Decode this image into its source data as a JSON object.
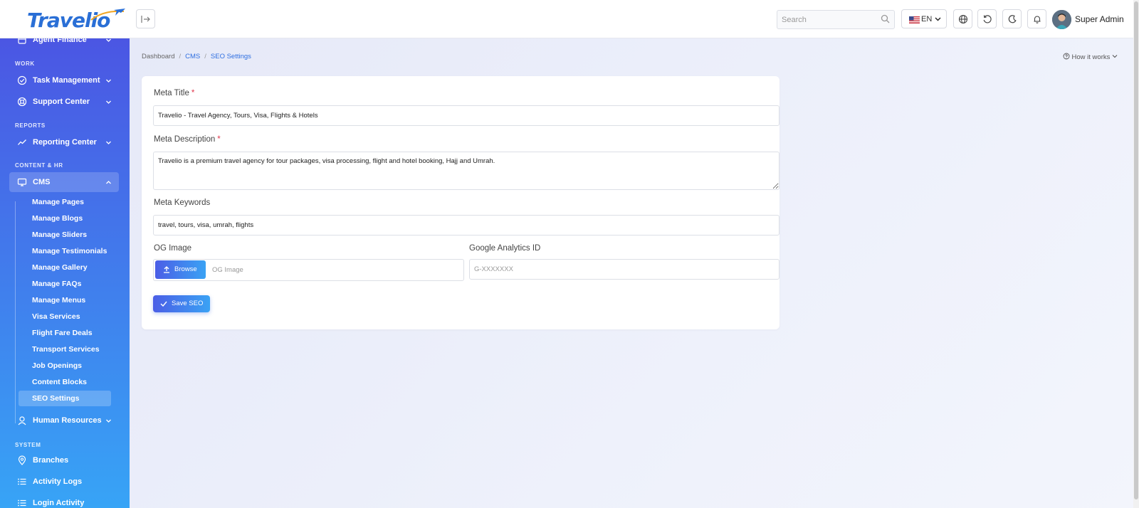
{
  "header": {
    "logo_text": "Travelio",
    "search_placeholder": "Search",
    "language": "EN",
    "user_name": "Super Admin"
  },
  "sidebar": {
    "top_item": "Agent Finance",
    "sections": {
      "work": "WORK",
      "reports": "REPORTS",
      "content_hr": "CONTENT & HR",
      "system": "SYSTEM"
    },
    "items": {
      "task_management": "Task Management",
      "support_center": "Support Center",
      "reporting_center": "Reporting Center",
      "cms": "CMS",
      "human_resources": "Human Resources",
      "branches": "Branches",
      "activity_logs": "Activity Logs",
      "login_activity": "Login Activity"
    },
    "cms_sub": [
      "Manage Pages",
      "Manage Blogs",
      "Manage Sliders",
      "Manage Testimonials",
      "Manage Gallery",
      "Manage FAQs",
      "Manage Menus",
      "Visa Services",
      "Flight Fare Deals",
      "Transport Services",
      "Job Openings",
      "Content Blocks",
      "SEO Settings"
    ]
  },
  "breadcrumb": {
    "home": "Dashboard",
    "section": "CMS",
    "current": "SEO Settings"
  },
  "how_it_works": "How it works",
  "form": {
    "meta_title_label": "Meta Title",
    "meta_title_value": "Travelio - Travel Agency, Tours, Visa, Flights & Hotels",
    "meta_description_label": "Meta Description",
    "meta_description_value": "Travelio is a premium travel agency for tour packages, visa processing, flight and hotel booking, Hajj and Umrah.",
    "meta_keywords_label": "Meta Keywords",
    "meta_keywords_value": "travel, tours, visa, umrah, flights",
    "og_image_label": "OG Image",
    "og_image_placeholder": "OG Image",
    "browse_label": "Browse",
    "ga_label": "Google Analytics ID",
    "ga_placeholder": "G-XXXXXXX",
    "required_mark": "*",
    "save_label": "Save SEO"
  },
  "colors": {
    "accent": "#2f6fe0",
    "sidebar_top": "#4b56e3",
    "sidebar_bottom": "#37a4f6",
    "required": "#e0384d"
  }
}
